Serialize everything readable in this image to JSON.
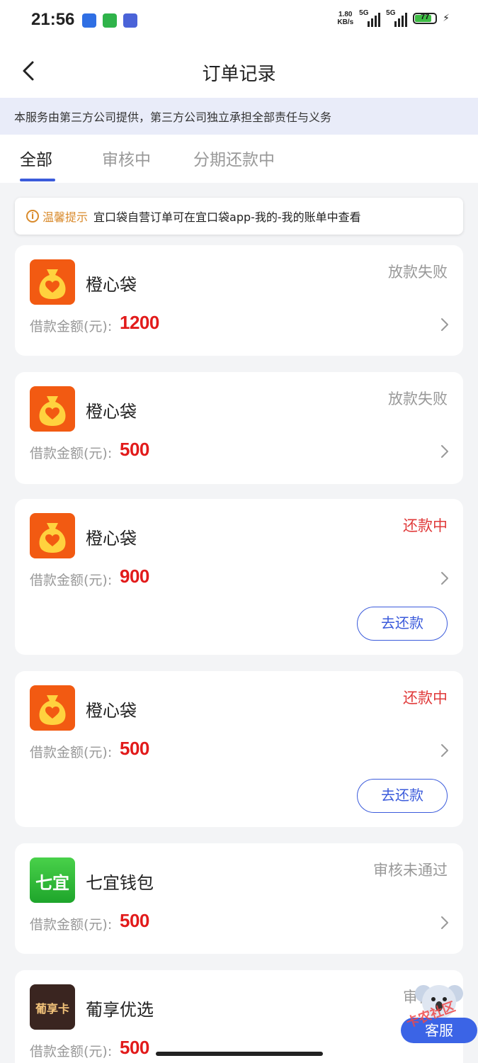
{
  "status_bar": {
    "time": "21:56",
    "net_speed_value": "1.80",
    "net_speed_unit": "KB/s",
    "sim1": "5G",
    "sim2": "5G",
    "battery": "77",
    "app_icon_colors": [
      "#2f6fe4",
      "#2fb34a",
      "#4a63d8"
    ]
  },
  "nav": {
    "title": "订单记录",
    "back_icon": "chevron-left-icon"
  },
  "notice": "本服务由第三方公司提供，第三方公司独立承担全部责任与义务",
  "tabs": [
    {
      "label": "全部",
      "active": true
    },
    {
      "label": "审核中",
      "active": false
    },
    {
      "label": "分期还款中",
      "active": false
    }
  ],
  "tip": {
    "label": "温馨提示",
    "text": "宜口袋自营订单可在宜口袋app-我的-我的账单中查看"
  },
  "orders": [
    {
      "name": "橙心袋",
      "status": "放款失败",
      "amount_label": "借款金额(元):",
      "amount": "1200",
      "logo": "money-bag-heart",
      "action": ""
    },
    {
      "name": "橙心袋",
      "status": "放款失败",
      "amount_label": "借款金额(元):",
      "amount": "500",
      "logo": "money-bag-heart",
      "action": ""
    },
    {
      "name": "橙心袋",
      "status": "还款中",
      "amount_label": "借款金额(元):",
      "amount": "900",
      "logo": "money-bag-heart",
      "action": "去还款"
    },
    {
      "name": "橙心袋",
      "status": "还款中",
      "amount_label": "借款金额(元):",
      "amount": "500",
      "logo": "money-bag-heart",
      "action": "去还款"
    },
    {
      "name": "七宜钱包",
      "status": "审核未通过",
      "amount_label": "借款金额(元):",
      "amount": "500",
      "logo_text": "七宜",
      "action": ""
    },
    {
      "name": "葡享优选",
      "status": "审核未",
      "amount_label": "借款金额(元):",
      "amount": "500",
      "logo_text": "葡享卡",
      "action": ""
    }
  ],
  "customer_service": {
    "label": "客服",
    "watermark": "卡农社区"
  },
  "colors": {
    "accent": "#3b5bdb",
    "amount_red": "#e21b1b",
    "status_red": "#e03a3a",
    "tip_orange": "#d98a2b",
    "logo_orange": "#f25a12"
  }
}
